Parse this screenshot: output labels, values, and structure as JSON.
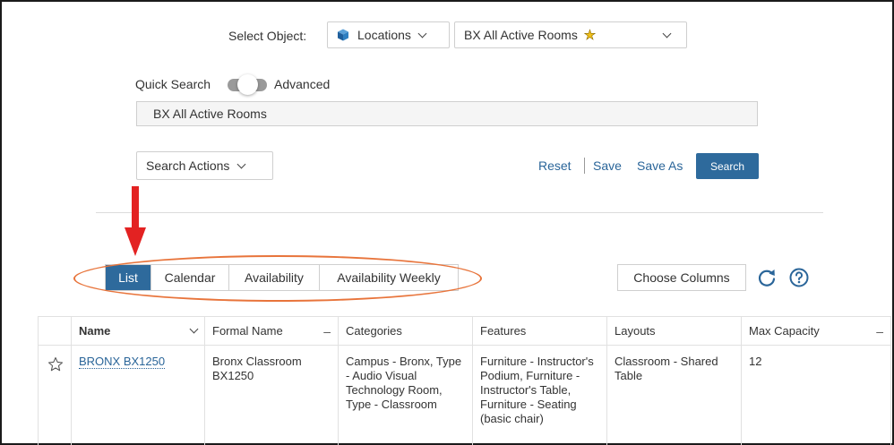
{
  "header": {
    "select_object_label": "Select Object:",
    "object_type": "Locations",
    "saved_search": "BX All Active Rooms",
    "saved_search_star": "★"
  },
  "search": {
    "quick_label": "Quick Search",
    "advanced_label": "Advanced",
    "mode": "Quick Search",
    "query_value": "BX All Active Rooms"
  },
  "actions": {
    "search_actions": "Search Actions",
    "reset": "Reset",
    "save": "Save",
    "save_as": "Save As",
    "search": "Search"
  },
  "views": {
    "tabs": [
      {
        "label": "List",
        "active": true
      },
      {
        "label": "Calendar",
        "active": false
      },
      {
        "label": "Availability",
        "active": false
      },
      {
        "label": "Availability Weekly",
        "active": false
      }
    ],
    "choose_columns": "Choose Columns"
  },
  "table": {
    "columns": [
      "Name",
      "Formal Name",
      "Categories",
      "Features",
      "Layouts",
      "Max Capacity"
    ],
    "rows": [
      {
        "name": "BRONX BX1250",
        "formal_name": "Bronx Classroom BX1250",
        "categories": "Campus - Bronx, Type - Audio Visual Technology Room, Type - Classroom",
        "features": "Furniture - Instructor's Podium, Furniture - Instructor's Table, Furniture - Seating (basic chair)",
        "layouts": "Classroom - Shared Table",
        "max_capacity": "12"
      }
    ]
  },
  "colors": {
    "accent": "#2e6a9c",
    "link": "#2a6599",
    "annotation_arrow": "#e32222",
    "annotation_ellipse": "#e8743b"
  }
}
